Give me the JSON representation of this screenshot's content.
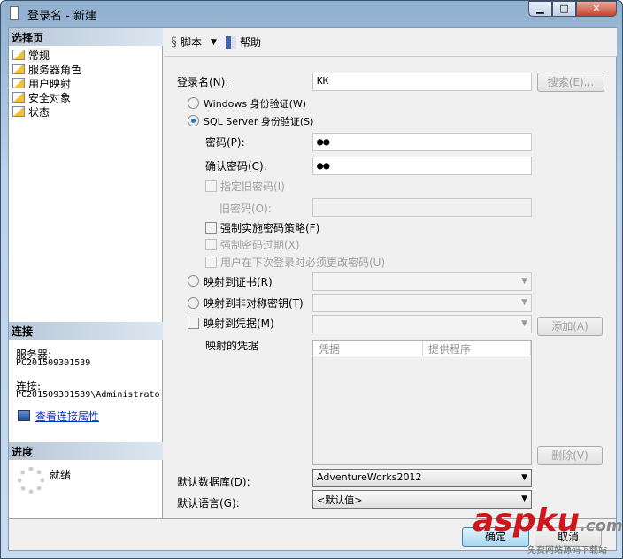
{
  "window": {
    "title": "登录名 - 新建",
    "controls": [
      "minimize",
      "maximize",
      "close"
    ]
  },
  "left": {
    "select_page_header": "选择页",
    "pages": [
      {
        "label": "常规",
        "selected": true
      },
      {
        "label": "服务器角色"
      },
      {
        "label": "用户映射"
      },
      {
        "label": "安全对象"
      },
      {
        "label": "状态"
      }
    ],
    "connection_header": "连接",
    "server_label": "服务器:",
    "server_value": "PC201509301539",
    "connection_label": "连接:",
    "connection_value": "PC201509301539\\Administrato",
    "view_props_link": "查看连接属性",
    "progress_header": "进度",
    "progress_status": "就绪"
  },
  "toolbar": {
    "script": "脚本",
    "help": "帮助"
  },
  "form": {
    "login_name_label": "登录名(N):",
    "login_name_value": "KK",
    "search_button": "搜索(E)...",
    "windows_auth": "Windows 身份验证(W)",
    "sql_auth": "SQL Server 身份验证(S)",
    "auth_selected": "sql",
    "password_label": "密码(P):",
    "password_value": "●●",
    "confirm_label": "确认密码(C):",
    "confirm_value": "●●",
    "specify_old": "指定旧密码(I)",
    "old_password_label": "旧密码(O):",
    "enforce_policy": "强制实施密码策略(F)",
    "enforce_expiration": "强制密码过期(X)",
    "must_change": "用户在下次登录时必须更改密码(U)",
    "map_cert": "映射到证书(R)",
    "map_asym": "映射到非对称密钥(T)",
    "map_cred": "映射到凭据(M)",
    "add_button": "添加(A)",
    "mapped_creds_label": "映射的凭据",
    "col_credential": "凭据",
    "col_provider": "提供程序",
    "remove_button": "删除(V)",
    "default_db_label": "默认数据库(D):",
    "default_db_value": "AdventureWorks2012",
    "default_lang_label": "默认语言(G):",
    "default_lang_value": "<默认值>"
  },
  "buttons": {
    "ok": "确定",
    "cancel": "取消"
  },
  "watermark": {
    "text": "aspku",
    "suffix": ".com",
    "sub": "免费网站源码下载站"
  }
}
